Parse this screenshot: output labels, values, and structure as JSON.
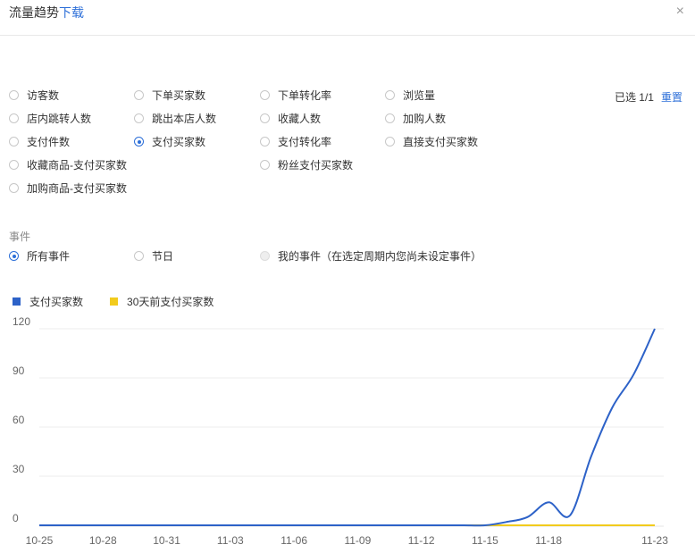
{
  "header": {
    "title": "流量趋势",
    "download": "下载",
    "close": "×"
  },
  "metrics": [
    {
      "label": "访客数",
      "checked": false
    },
    {
      "label": "下单买家数",
      "checked": false
    },
    {
      "label": "下单转化率",
      "checked": false
    },
    {
      "label": "浏览量",
      "checked": false
    },
    {
      "label": "店内跳转人数",
      "checked": false
    },
    {
      "label": "跳出本店人数",
      "checked": false
    },
    {
      "label": "收藏人数",
      "checked": false
    },
    {
      "label": "加购人数",
      "checked": false
    },
    {
      "label": "支付件数",
      "checked": false
    },
    {
      "label": "支付买家数",
      "checked": true
    },
    {
      "label": "支付转化率",
      "checked": false
    },
    {
      "label": "直接支付买家数",
      "checked": false
    },
    {
      "label": "收藏商品-支付买家数",
      "checked": false
    },
    {
      "label": "粉丝支付买家数",
      "checked": false
    },
    {
      "label": "加购商品-支付买家数",
      "checked": false
    }
  ],
  "selection": {
    "info": "已选 1/1",
    "reset": "重置"
  },
  "events": {
    "label": "事件",
    "options": [
      {
        "label": "所有事件",
        "checked": true,
        "disabled": false
      },
      {
        "label": "节日",
        "checked": false,
        "disabled": false
      },
      {
        "label": "我的事件（在选定周期内您尚未设定事件）",
        "checked": false,
        "disabled": true
      }
    ]
  },
  "colors": {
    "series1": "#2d62c8",
    "series2": "#f2cb1d",
    "accent": "#2d6fd8"
  },
  "chart_data": {
    "type": "line",
    "ylim": [
      0,
      120
    ],
    "yticks": [
      "0",
      "30",
      "60",
      "90",
      "120"
    ],
    "xticks": [
      "10-25",
      "10-28",
      "10-31",
      "11-03",
      "11-06",
      "11-09",
      "11-12",
      "11-15",
      "11-18",
      "11-23"
    ],
    "x": [
      "10-25",
      "10-26",
      "10-27",
      "10-28",
      "10-29",
      "10-30",
      "10-31",
      "11-01",
      "11-02",
      "11-03",
      "11-04",
      "11-05",
      "11-06",
      "11-07",
      "11-08",
      "11-09",
      "11-10",
      "11-11",
      "11-12",
      "11-13",
      "11-14",
      "11-15",
      "11-16",
      "11-17",
      "11-18",
      "11-19",
      "11-20",
      "11-21",
      "11-22",
      "11-23"
    ],
    "series": [
      {
        "name": "支付买家数",
        "values": [
          0,
          0,
          0,
          0,
          0,
          0,
          0,
          0,
          0,
          0,
          0,
          0,
          0,
          0,
          0,
          0,
          0,
          0,
          0,
          0,
          0,
          0,
          2,
          5,
          14,
          6,
          42,
          72,
          92,
          120
        ]
      },
      {
        "name": "30天前支付买家数",
        "values": [
          0,
          0,
          0,
          0,
          0,
          0,
          0,
          0,
          0,
          0,
          0,
          0,
          0,
          0,
          0,
          0,
          0,
          0,
          0,
          0,
          0,
          0,
          0,
          0,
          0,
          0,
          0,
          0,
          0,
          0
        ]
      }
    ]
  }
}
